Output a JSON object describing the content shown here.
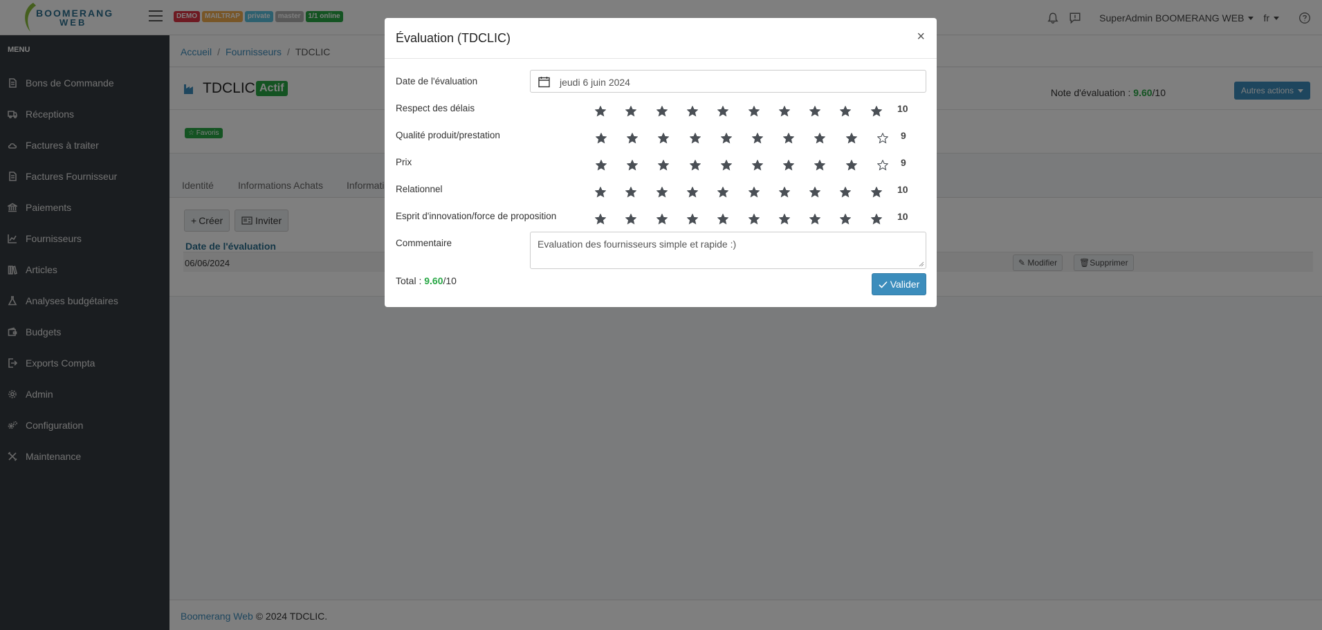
{
  "header": {
    "logo_line1": "BOOMERANG",
    "logo_line2": "WEB",
    "badges": [
      {
        "label": "DEMO",
        "color": "#dc3545"
      },
      {
        "label": "MAILTRAP",
        "color": "#f0ad4e"
      },
      {
        "label": "private",
        "color": "#5bc0de"
      },
      {
        "label": "master",
        "color": "#aaaaaa"
      },
      {
        "label": "1/1 online",
        "color": "#28a745"
      }
    ],
    "user": "SuperAdmin BOOMERANG WEB",
    "language": "fr"
  },
  "sidebar": {
    "title": "MENU",
    "items": [
      {
        "label": "Bons de Commande",
        "icon": "document-icon"
      },
      {
        "label": "Réceptions",
        "icon": "truck-icon"
      },
      {
        "label": "Factures à traiter",
        "icon": "cloud-icon"
      },
      {
        "label": "Factures Fournisseur",
        "icon": "document-icon"
      },
      {
        "label": "Paiements",
        "icon": "bank-icon"
      },
      {
        "label": "Fournisseurs",
        "icon": "chart-icon"
      },
      {
        "label": "Articles",
        "icon": "books-icon"
      },
      {
        "label": "Analyses budgétaires",
        "icon": "flask-icon"
      },
      {
        "label": "Budgets",
        "icon": "wallet-icon"
      },
      {
        "label": "Exports Compta",
        "icon": "export-icon"
      },
      {
        "label": "Admin",
        "icon": "gear-icon"
      },
      {
        "label": "Configuration",
        "icon": "gears-icon"
      },
      {
        "label": "Maintenance",
        "icon": "tools-icon"
      }
    ]
  },
  "breadcrumb": {
    "home": "Accueil",
    "suppliers": "Fournisseurs",
    "current": "TDCLIC"
  },
  "supplier": {
    "name": "TDCLIC",
    "status": "Actif",
    "note_label": "Note d'évaluation : ",
    "note_value": "9.60",
    "note_max": "/10",
    "other_actions": "Autres actions",
    "favorites": "Favoris"
  },
  "tabs": [
    "Identité",
    "Informations Achats",
    "Informati"
  ],
  "panel": {
    "create": "Créer",
    "invite": "Inviter",
    "column_date": "Date de l'évaluation",
    "row_date": "06/06/2024",
    "edit": "Modifier",
    "delete": "Supprimer"
  },
  "footer": {
    "link": "Boomerang Web",
    "text": " © 2024 TDCLIC."
  },
  "modal": {
    "title": "Évaluation (TDCLIC)",
    "close": "×",
    "date_label": "Date de l'évaluation",
    "date_value": "jeudi 6 juin 2024",
    "criteria": [
      {
        "label": "Respect des délais",
        "score": 10
      },
      {
        "label": "Qualité produit/prestation",
        "score": 9
      },
      {
        "label": "Prix",
        "score": 9
      },
      {
        "label": "Relationnel",
        "score": 10
      },
      {
        "label": "Esprit d'innovation/force de proposition",
        "score": 10
      }
    ],
    "stars_max": 10,
    "comment_label": "Commentaire",
    "comment_value": "Evaluation des fournisseurs simple et rapide :)",
    "total_label": "Total : ",
    "total_value": "9.60",
    "total_max": "/10",
    "submit": "Valider"
  }
}
